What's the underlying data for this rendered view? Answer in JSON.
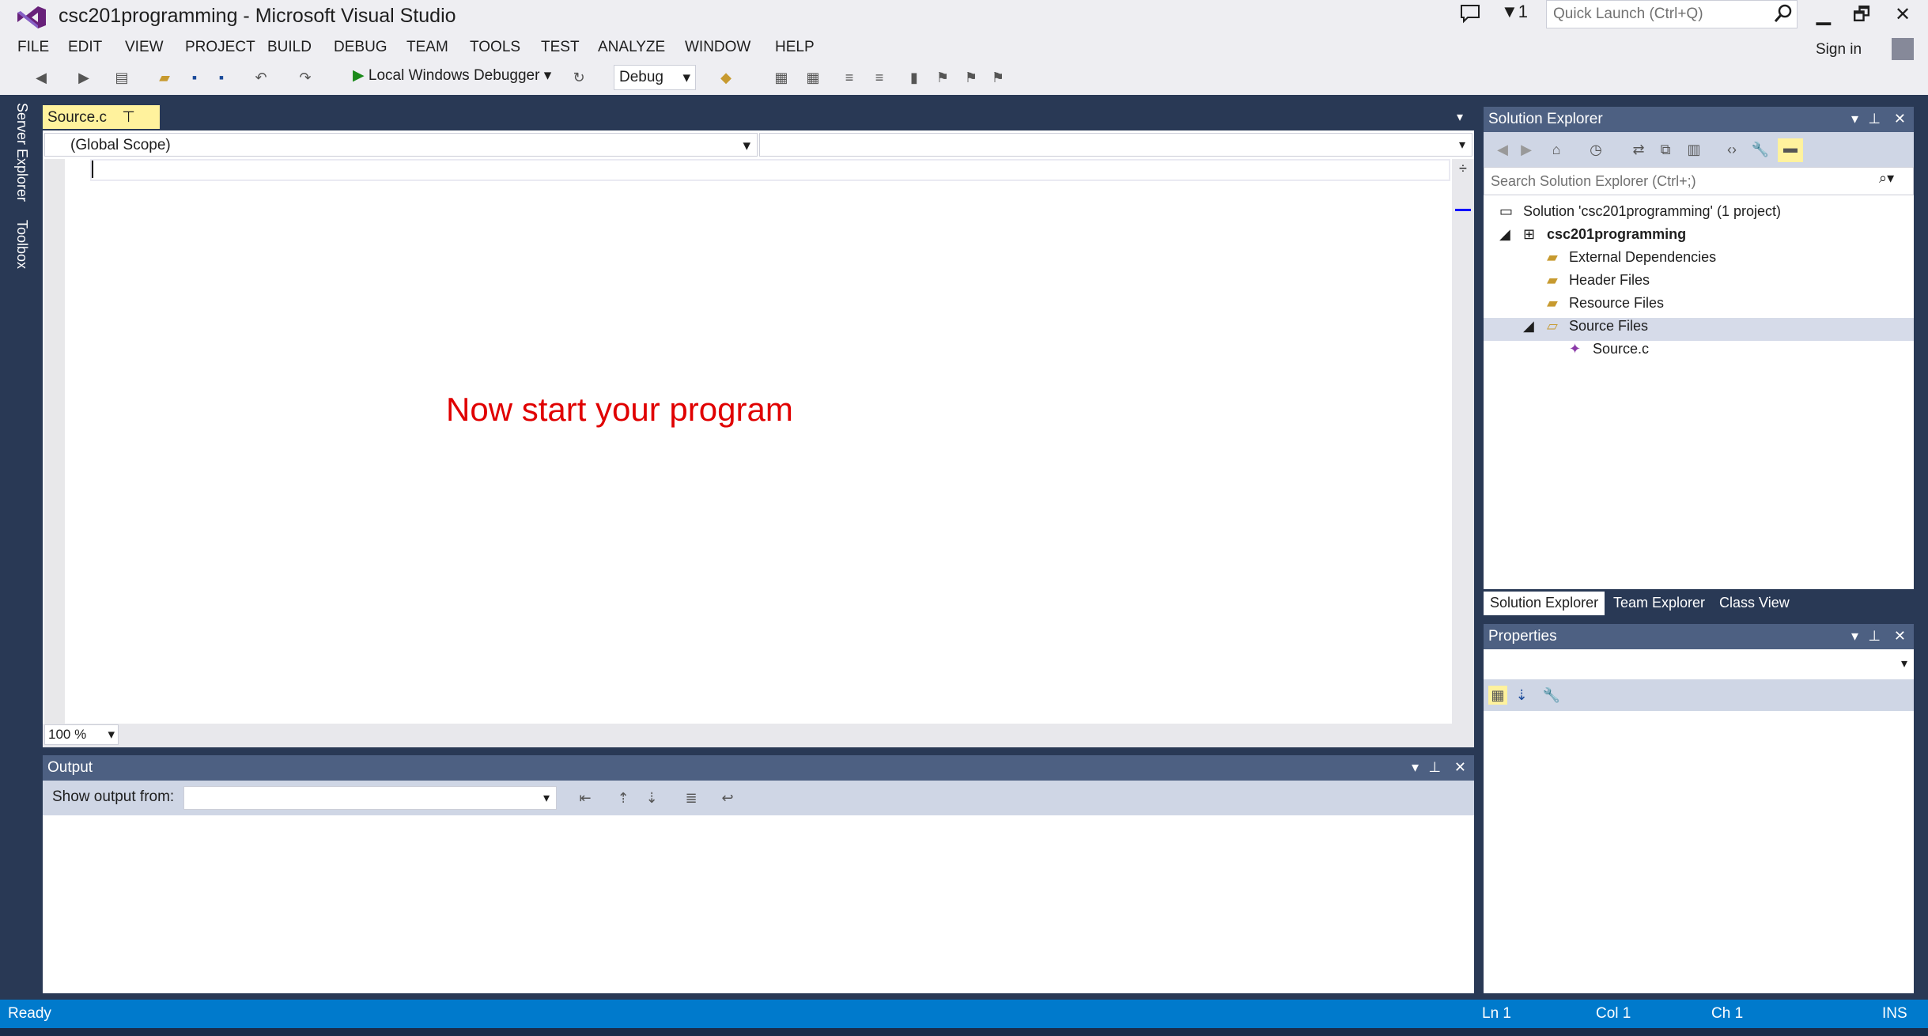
{
  "window": {
    "title": "csc201programming - Microsoft Visual Studio",
    "notification_count": "1",
    "quick_launch_placeholder": "Quick Launch (Ctrl+Q)",
    "sign_in": "Sign in"
  },
  "menu": [
    "FILE",
    "EDIT",
    "VIEW",
    "PROJECT",
    "BUILD",
    "DEBUG",
    "TEAM",
    "TOOLS",
    "TEST",
    "ANALYZE",
    "WINDOW",
    "HELP"
  ],
  "toolbar": {
    "debugger_label": "Local Windows Debugger",
    "configuration": "Debug"
  },
  "side_tabs": {
    "server_explorer": "Server Explorer",
    "toolbox": "Toolbox"
  },
  "editor": {
    "tab_label": "Source.c",
    "scope": "(Global Scope)",
    "zoom": "100 %",
    "overlay_text": "Now start your program"
  },
  "output": {
    "title": "Output",
    "show_output_label": "Show output from:"
  },
  "solution_explorer": {
    "title": "Solution Explorer",
    "search_placeholder": "Search Solution Explorer (Ctrl+;)",
    "tree": {
      "solution": "Solution 'csc201programming' (1 project)",
      "project": "csc201programming",
      "external": "External Dependencies",
      "header": "Header Files",
      "resource": "Resource Files",
      "source": "Source Files",
      "source_file": "Source.c"
    },
    "tabs": [
      "Solution Explorer",
      "Team Explorer",
      "Class View"
    ]
  },
  "properties": {
    "title": "Properties"
  },
  "status": {
    "state": "Ready",
    "line": "Ln 1",
    "col": "Col 1",
    "ch": "Ch 1",
    "mode": "INS"
  },
  "colors": {
    "accent": "#007acc",
    "tab_active": "#fff29d",
    "panel_header": "#4d6082",
    "frame": "#293955",
    "overlay_text": "#e00000"
  },
  "icons": [
    "vs-logo-icon",
    "notification-icon",
    "filter-icon",
    "search-icon",
    "minimize-icon",
    "restore-icon",
    "close-icon",
    "play-icon",
    "pin-icon",
    "home-icon",
    "wrench-icon"
  ]
}
